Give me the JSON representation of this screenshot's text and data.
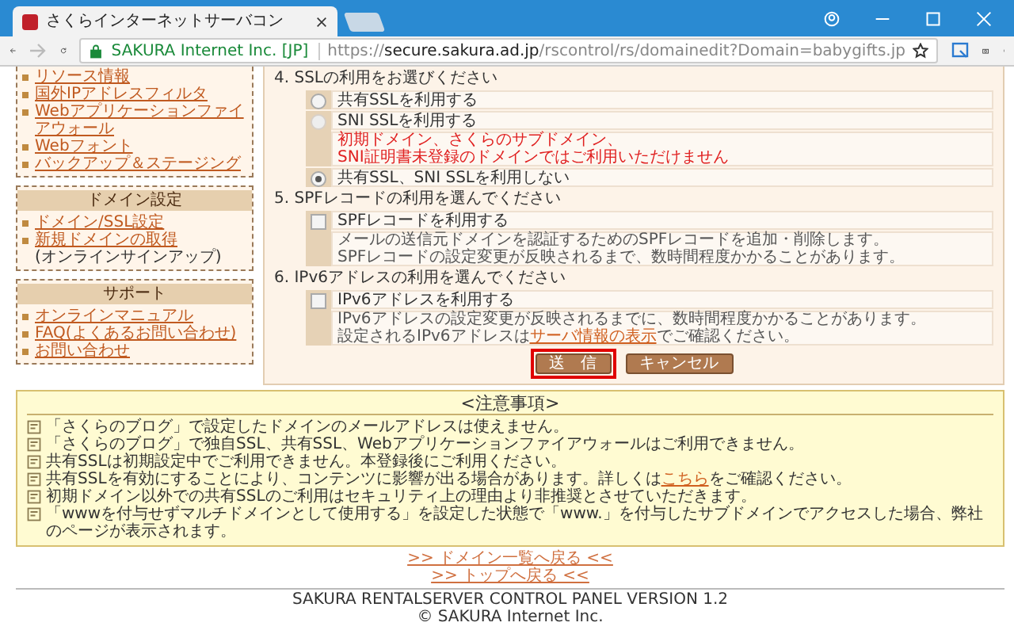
{
  "browser": {
    "tab_title": "さくらインターネットサーバコン",
    "site_identity": "SAKURA Internet Inc. [JP]",
    "url_scheme": "https://",
    "url_host": "secure.sakura.ad.jp",
    "url_path": "/rscontrol/rs/domainedit?Domain=babygifts.jp"
  },
  "sidebar": [
    {
      "items": [
        {
          "label": "リソース情報"
        },
        {
          "label": "国外IPアドレスフィルタ"
        },
        {
          "label": "Webアプリケーションファイアウォール"
        },
        {
          "label": "Webフォント"
        },
        {
          "label": "バックアップ＆ステージング"
        }
      ]
    },
    {
      "title": "ドメイン設定",
      "items": [
        {
          "label": "ドメイン/SSL設定"
        },
        {
          "label": "新規ドメインの取得",
          "note": "(オンラインサインアップ)"
        }
      ]
    },
    {
      "title": "サポート",
      "items": [
        {
          "label": "オンラインマニュアル"
        },
        {
          "label": "FAQ(よくあるお問い合わせ)"
        },
        {
          "label": "お問い合わせ"
        }
      ]
    }
  ],
  "form": {
    "sections": [
      {
        "kind": "radio",
        "heading": "4. SSLの利用をお選びください",
        "options": [
          {
            "label": "共有SSLを利用する",
            "selected": false,
            "disabled": false
          },
          {
            "label": "SNI SSLを利用する",
            "selected": false,
            "disabled": true,
            "warning": [
              "初期ドメイン、さくらのサブドメイン、",
              "SNI証明書未登録のドメインではご利用いただけません"
            ]
          },
          {
            "label": "共有SSL、SNI SSLを利用しない",
            "selected": true,
            "disabled": false
          }
        ]
      },
      {
        "kind": "checkbox",
        "heading": "5. SPFレコードの利用を選んでください",
        "options": [
          {
            "label": "SPFレコードを利用する",
            "checked": false,
            "description": [
              {
                "text": "メールの送信元ドメインを認証するためのSPFレコードを追加・削除します。"
              },
              {
                "text": "SPFレコードの設定変更が反映されるまで、数時間程度かかることがあります。"
              }
            ]
          }
        ]
      },
      {
        "kind": "checkbox",
        "heading": "6. IPv6アドレスの利用を選んでください",
        "options": [
          {
            "label": "IPv6アドレスを利用する",
            "checked": false,
            "description": [
              {
                "text": "IPv6アドレスの設定変更が反映されるまでに、数時間程度かかることがあります。"
              },
              {
                "text": "設定されるIPv6アドレスは",
                "link": "サーバ情報の表示",
                "after": "でご確認ください。"
              }
            ]
          }
        ]
      }
    ],
    "buttons": [
      {
        "label": "送　信",
        "highlighted": true
      },
      {
        "label": "キャンセル",
        "highlighted": false
      }
    ]
  },
  "notice": {
    "title": "<注意事項>",
    "items": [
      {
        "text": "「さくらのブログ」で設定したドメインのメールアドレスは使えません。"
      },
      {
        "text": "「さくらのブログ」で独自SSL、共有SSL、Webアプリケーションファイアウォールはご利用できません。"
      },
      {
        "text": "共有SSLは初期設定中でご利用できません。本登録後にご利用ください。"
      },
      {
        "text": "共有SSLを有効にすることにより、コンテンツに影響が出る場合があります。詳しくは",
        "link": "こちら",
        "after": "をご確認ください。"
      },
      {
        "text": "初期ドメイン以外での共有SSLのご利用はセキュリティ上の理由より非推奨とさせていただきます。"
      },
      {
        "text": "「wwwを付与せずマルチドメインとして使用する」を設定した状態で「www.」を付与したサブドメインでアクセスした場合、弊社のページが表示されます。"
      }
    ]
  },
  "footer_links": [
    ">> ドメイン一覧へ戻る <<",
    ">> トップへ戻る <<"
  ],
  "footer": {
    "product": "SAKURA RENTALSERVER CONTROL PANEL VERSION 1.2",
    "copyright": "© SAKURA Internet Inc."
  }
}
